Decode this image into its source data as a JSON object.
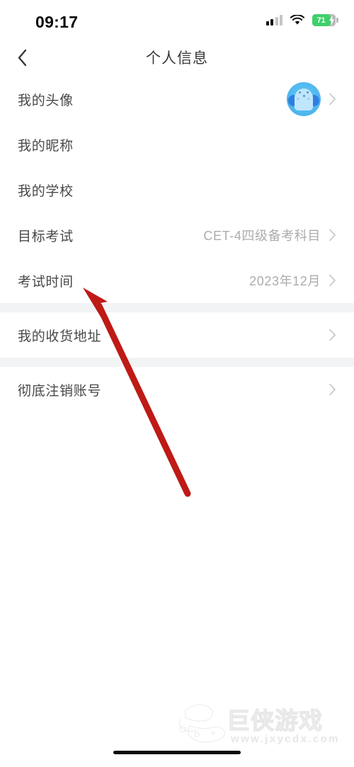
{
  "status_bar": {
    "time": "09:17",
    "signal_icon": "cellular-signal-icon",
    "wifi_icon": "wifi-icon",
    "battery": {
      "level_text": "71",
      "charging": true,
      "fill_color": "#3fd06a"
    }
  },
  "nav": {
    "back_icon": "chevron-left-icon",
    "title": "个人信息"
  },
  "colors": {
    "page_bg": "#ffffff",
    "section_gap": "#f2f3f5",
    "label": "#484848",
    "value": "#acacac",
    "chevron": "#c8c8c8",
    "annotation": "#be1a16",
    "avatar_blue": "#4fb8ef"
  },
  "groups": [
    {
      "rows": [
        {
          "label": "我的头像",
          "value": "",
          "avatar": "user-avatar",
          "chevron": true
        },
        {
          "label": "我的昵称",
          "value": "",
          "avatar": null,
          "chevron": false
        },
        {
          "label": "我的学校",
          "value": "",
          "avatar": null,
          "chevron": false
        },
        {
          "label": "目标考试",
          "value": "CET-4四级备考科目",
          "avatar": null,
          "chevron": true
        },
        {
          "label": "考试时间",
          "value": "2023年12月",
          "avatar": null,
          "chevron": true
        }
      ]
    },
    {
      "rows": [
        {
          "label": "我的收货地址",
          "value": "",
          "avatar": null,
          "chevron": true
        }
      ]
    },
    {
      "rows": [
        {
          "label": "彻底注销账号",
          "value": "",
          "avatar": null,
          "chevron": true
        }
      ]
    }
  ],
  "annotation": {
    "type": "arrow-pointer",
    "points_at": "考试时间",
    "color": "#be1a16"
  },
  "watermark": {
    "title": "巨侠游戏",
    "url": "www.jxycdx.com"
  },
  "home_indicator": "home-indicator-bar"
}
